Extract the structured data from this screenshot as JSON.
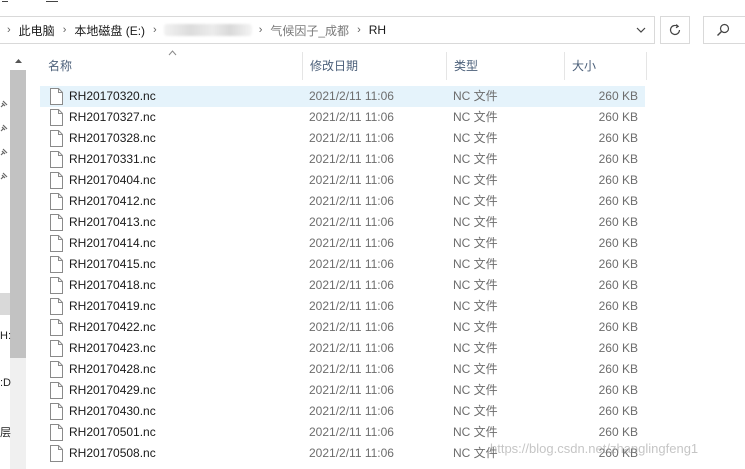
{
  "breadcrumb": {
    "items": [
      "此电脑",
      "本地磁盘 (E:)",
      "气候因子_成都",
      "RH"
    ]
  },
  "columns": {
    "name": "名称",
    "modified": "修改日期",
    "type": "类型",
    "size": "大小"
  },
  "nav_fragments": [
    "H:",
    ":D",
    "层"
  ],
  "files": [
    {
      "name": "RH20170320.nc",
      "modified": "2021/2/11 11:06",
      "type": "NC 文件",
      "size": "260 KB"
    },
    {
      "name": "RH20170327.nc",
      "modified": "2021/2/11 11:06",
      "type": "NC 文件",
      "size": "260 KB"
    },
    {
      "name": "RH20170328.nc",
      "modified": "2021/2/11 11:06",
      "type": "NC 文件",
      "size": "260 KB"
    },
    {
      "name": "RH20170331.nc",
      "modified": "2021/2/11 11:06",
      "type": "NC 文件",
      "size": "260 KB"
    },
    {
      "name": "RH20170404.nc",
      "modified": "2021/2/11 11:06",
      "type": "NC 文件",
      "size": "260 KB"
    },
    {
      "name": "RH20170412.nc",
      "modified": "2021/2/11 11:06",
      "type": "NC 文件",
      "size": "260 KB"
    },
    {
      "name": "RH20170413.nc",
      "modified": "2021/2/11 11:06",
      "type": "NC 文件",
      "size": "260 KB"
    },
    {
      "name": "RH20170414.nc",
      "modified": "2021/2/11 11:06",
      "type": "NC 文件",
      "size": "260 KB"
    },
    {
      "name": "RH20170415.nc",
      "modified": "2021/2/11 11:06",
      "type": "NC 文件",
      "size": "260 KB"
    },
    {
      "name": "RH20170418.nc",
      "modified": "2021/2/11 11:06",
      "type": "NC 文件",
      "size": "260 KB"
    },
    {
      "name": "RH20170419.nc",
      "modified": "2021/2/11 11:06",
      "type": "NC 文件",
      "size": "260 KB"
    },
    {
      "name": "RH20170422.nc",
      "modified": "2021/2/11 11:06",
      "type": "NC 文件",
      "size": "260 KB"
    },
    {
      "name": "RH20170423.nc",
      "modified": "2021/2/11 11:06",
      "type": "NC 文件",
      "size": "260 KB"
    },
    {
      "name": "RH20170428.nc",
      "modified": "2021/2/11 11:06",
      "type": "NC 文件",
      "size": "260 KB"
    },
    {
      "name": "RH20170429.nc",
      "modified": "2021/2/11 11:06",
      "type": "NC 文件",
      "size": "260 KB"
    },
    {
      "name": "RH20170430.nc",
      "modified": "2021/2/11 11:06",
      "type": "NC 文件",
      "size": "260 KB"
    },
    {
      "name": "RH20170501.nc",
      "modified": "2021/2/11 11:06",
      "type": "NC 文件",
      "size": "260 KB"
    },
    {
      "name": "RH20170508.nc",
      "modified": "2021/2/11 11:06",
      "type": "NC 文件",
      "size": "260 KB"
    }
  ],
  "watermark": "https://blog.csdn.net/zhanglingfeng1",
  "colors": {
    "selected_row": "#e5f3fb",
    "header_text": "#4c607a",
    "secondary_text": "#6d6d6d"
  }
}
